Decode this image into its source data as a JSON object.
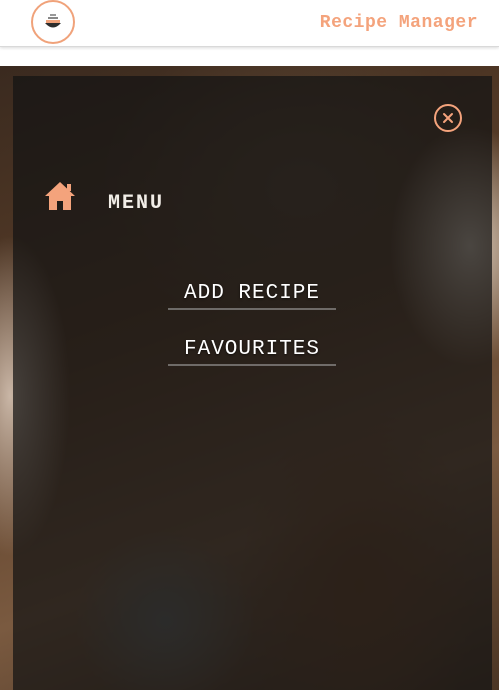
{
  "header": {
    "app_title": "Recipe Manager",
    "logo_icon": "cooking-pot-icon"
  },
  "menu": {
    "title": "MENU",
    "home_icon": "home-icon",
    "close_icon": "close-icon",
    "links": [
      {
        "label": "ADD RECIPE"
      },
      {
        "label": "FAVOURITES"
      }
    ]
  },
  "colors": {
    "accent": "#f4a37c",
    "overlay": "#141414"
  }
}
